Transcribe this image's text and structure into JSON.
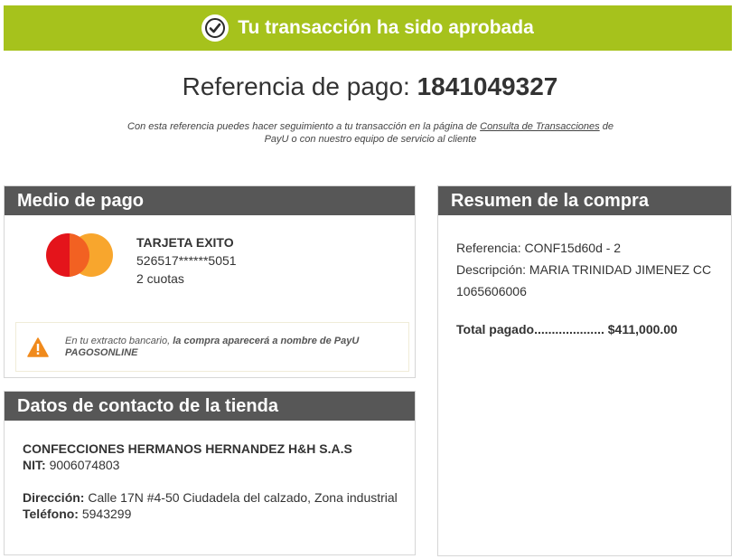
{
  "banner": {
    "text": "Tu transacción ha sido aprobada",
    "icon": "check-circle-icon",
    "color": "#a6c21c"
  },
  "reference": {
    "label": "Referencia de pago:",
    "number": "1841049327",
    "note_before": "Con esta referencia puedes hacer seguimiento a tu transacción en la página de",
    "note_link": "Consulta de Transacciones",
    "note_after": "de PayU o con nuestro equipo de servicio al cliente"
  },
  "payment": {
    "header": "Medio de pago",
    "card_logo": "mastercard-logo",
    "card_name": "TARJETA EXITO",
    "card_number": "526517******5051",
    "installments": "2 cuotas",
    "notice_prefix": "En tu extracto bancario,",
    "notice_bold": "la compra aparecerá a nombre de PayU PAGOSONLINE",
    "notice_icon": "warning-icon"
  },
  "store": {
    "header": "Datos de contacto de la tienda",
    "name": "CONFECCIONES HERMANOS HERNANDEZ H&H S.A.S",
    "nit_label": "NIT:",
    "nit_value": "9006074803",
    "address_label": "Dirección:",
    "address_value": "Calle 17N #4-50 Ciudadela del calzado, Zona industrial",
    "phone_label": "Teléfono:",
    "phone_value": "5943299"
  },
  "summary": {
    "header": "Resumen de la compra",
    "reference_label": "Referencia:",
    "reference_value": "CONF15d60d - 2",
    "description_label": "Descripción:",
    "description_value": "MARIA TRINIDAD JIMENEZ CC 1065606006",
    "total_label": "Total pagado....................",
    "total_value": "$411,000.00"
  },
  "colors": {
    "header_bg": "#575757",
    "mastercard_red": "#e4141b",
    "mastercard_orange": "#f79e1b",
    "warning": "#f08a1c"
  }
}
